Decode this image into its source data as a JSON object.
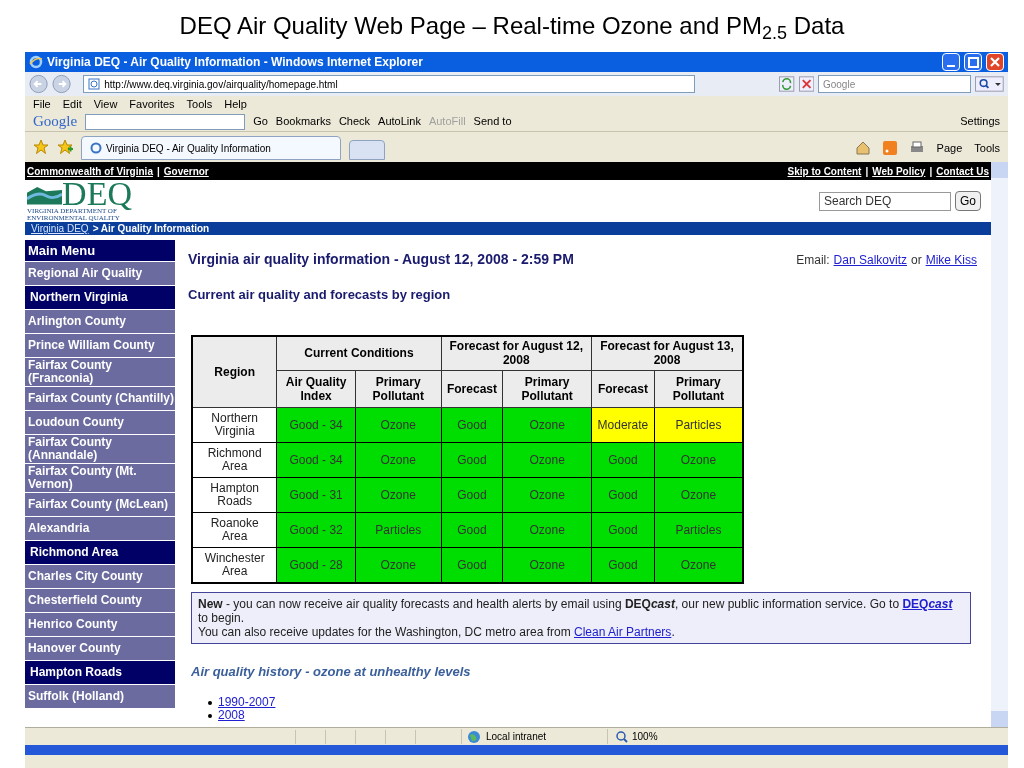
{
  "slide_title": "DEQ Air Quality Web Page – Real-time Ozone and PM$_{2.5}$ Data",
  "window": {
    "title": "Virginia DEQ - Air Quality Information - Windows Internet Explorer"
  },
  "address_bar": {
    "url": "http://www.deq.virginia.gov/airquality/homepage.html"
  },
  "search_box": {
    "placeholder": "Google"
  },
  "menu": [
    "File",
    "Edit",
    "View",
    "Favorites",
    "Tools",
    "Help"
  ],
  "google_toolbar": {
    "logo": "Google",
    "go": "Go",
    "items": [
      {
        "label": "Bookmarks",
        "disabled": false
      },
      {
        "label": "Check",
        "disabled": false
      },
      {
        "label": "AutoLink",
        "disabled": false
      },
      {
        "label": "AutoFill",
        "disabled": true
      },
      {
        "label": "Send to",
        "disabled": false
      }
    ],
    "settings": "Settings"
  },
  "tabs": [
    {
      "label": "Virginia DEQ - Air Quality Information",
      "selected": true
    }
  ],
  "command_bar": [
    "Page",
    "Tools"
  ],
  "page": {
    "top_links_left": [
      {
        "text": "Commonwealth of Virginia",
        "kind": "link"
      },
      {
        "text": "|",
        "kind": "separator"
      },
      {
        "text": "Governor",
        "kind": "link"
      }
    ],
    "top_links_right": [
      {
        "text": "Skip to Content",
        "kind": "link"
      },
      {
        "text": "|",
        "kind": "separator"
      },
      {
        "text": "Web Policy",
        "kind": "link"
      },
      {
        "text": "|",
        "kind": "separator"
      },
      {
        "text": "Contact Us",
        "kind": "link"
      }
    ],
    "logo": {
      "mark": "DEQ",
      "subtitle_lines": [
        "VIRGINIA DEPARTMENT OF",
        "ENVIRONMENTAL QUALITY"
      ]
    },
    "site_search": {
      "value": "Search DEQ",
      "button": "Go"
    },
    "breadcrumb": [
      {
        "text": "Virginia DEQ",
        "kind": "link"
      },
      {
        "text": "> Air Quality Information",
        "kind": "current"
      }
    ],
    "sidebar": [
      {
        "label": "Main Menu",
        "kind": "header"
      },
      {
        "label": "Regional Air Quality",
        "kind": "item"
      },
      {
        "label": "Northern Virginia",
        "kind": "section"
      },
      {
        "label": "Arlington County",
        "kind": "item"
      },
      {
        "label": "Prince William County",
        "kind": "item"
      },
      {
        "label": "Fairfax County (Franconia)",
        "kind": "item"
      },
      {
        "label": "Fairfax County (Chantilly)",
        "kind": "item"
      },
      {
        "label": "Loudoun County",
        "kind": "item"
      },
      {
        "label": "Fairfax County (Annandale)",
        "kind": "item"
      },
      {
        "label": "Fairfax County (Mt. Vernon)",
        "kind": "item"
      },
      {
        "label": "Fairfax County (McLean)",
        "kind": "item"
      },
      {
        "label": "Alexandria",
        "kind": "item"
      },
      {
        "label": "Richmond Area",
        "kind": "section"
      },
      {
        "label": "Charles City County",
        "kind": "item"
      },
      {
        "label": "Chesterfield County",
        "kind": "item"
      },
      {
        "label": "Henrico County",
        "kind": "item"
      },
      {
        "label": "Hanover County",
        "kind": "item"
      },
      {
        "label": "Hampton Roads",
        "kind": "section"
      },
      {
        "label": "Suffolk (Holland)",
        "kind": "item"
      }
    ],
    "heading": "Virginia air quality information - August 12, 2008 - 2:59 PM",
    "email": {
      "label": "Email:",
      "contacts": [
        "Dan Salkovitz",
        "Mike Kiss"
      ],
      "joiner": "or"
    },
    "subheading": "Current air quality and forecasts by region",
    "table": {
      "region_header": "Region",
      "groups": [
        {
          "title": "Current Conditions",
          "columns": [
            "Air Quality Index",
            "Primary Pollutant"
          ]
        },
        {
          "title": "Forecast for August 12, 2008",
          "columns": [
            "Forecast",
            "Primary Pollutant"
          ]
        },
        {
          "title": "Forecast for August 13, 2008",
          "columns": [
            "Forecast",
            "Primary Pollutant"
          ]
        }
      ],
      "rows": [
        {
          "region": "Northern Virginia",
          "cells": [
            {
              "text": "Good - 34",
              "color": "#00dd00"
            },
            {
              "text": "Ozone",
              "color": "#00dd00"
            },
            {
              "text": "Good",
              "color": "#00dd00"
            },
            {
              "text": "Ozone",
              "color": "#00dd00"
            },
            {
              "text": "Moderate",
              "color": "#ffff00"
            },
            {
              "text": "Particles",
              "color": "#ffff00"
            }
          ]
        },
        {
          "region": "Richmond Area",
          "cells": [
            {
              "text": "Good - 34",
              "color": "#00dd00"
            },
            {
              "text": "Ozone",
              "color": "#00dd00"
            },
            {
              "text": "Good",
              "color": "#00dd00"
            },
            {
              "text": "Ozone",
              "color": "#00dd00"
            },
            {
              "text": "Good",
              "color": "#00dd00"
            },
            {
              "text": "Ozone",
              "color": "#00dd00"
            }
          ]
        },
        {
          "region": "Hampton Roads",
          "cells": [
            {
              "text": "Good - 31",
              "color": "#00dd00"
            },
            {
              "text": "Ozone",
              "color": "#00dd00"
            },
            {
              "text": "Good",
              "color": "#00dd00"
            },
            {
              "text": "Ozone",
              "color": "#00dd00"
            },
            {
              "text": "Good",
              "color": "#00dd00"
            },
            {
              "text": "Ozone",
              "color": "#00dd00"
            }
          ]
        },
        {
          "region": "Roanoke Area",
          "cells": [
            {
              "text": "Good - 32",
              "color": "#00dd00"
            },
            {
              "text": "Particles",
              "color": "#00dd00"
            },
            {
              "text": "Good",
              "color": "#00dd00"
            },
            {
              "text": "Ozone",
              "color": "#00dd00"
            },
            {
              "text": "Good",
              "color": "#00dd00"
            },
            {
              "text": "Particles",
              "color": "#00dd00"
            }
          ]
        },
        {
          "region": "Winchester Area",
          "cells": [
            {
              "text": "Good - 28",
              "color": "#00dd00"
            },
            {
              "text": "Ozone",
              "color": "#00dd00"
            },
            {
              "text": "Good",
              "color": "#00dd00"
            },
            {
              "text": "Ozone",
              "color": "#00dd00"
            },
            {
              "text": "Good",
              "color": "#00dd00"
            },
            {
              "text": "Ozone",
              "color": "#00dd00"
            }
          ]
        }
      ]
    },
    "notice": {
      "line1_parts": [
        {
          "text": "New",
          "kind": "strong"
        },
        {
          "text": " - you can now receive air quality forecasts and health alerts by email using ",
          "kind": "plain"
        },
        {
          "text": "DEQ",
          "kind": "strong"
        },
        {
          "text": "cast",
          "kind": "emphasis"
        },
        {
          "text": ", our new public information service. Go to ",
          "kind": "plain"
        }
      ],
      "line1_link_parts": [
        {
          "text": "DEQ",
          "kind": "strong"
        },
        {
          "text": "cast",
          "kind": "emphasis"
        }
      ],
      "line1_after": " to begin.",
      "line2_before": "You can also receive updates for the Washington, DC metro area from ",
      "line2_link": "Clean Air Partners",
      "line2_after": "."
    },
    "history_heading": "Air quality history - ozone at unhealthy levels",
    "history_links": [
      "1990-2007",
      "2008"
    ]
  },
  "status_bar": {
    "zone": "Local intranet",
    "zoom": "100%"
  }
}
